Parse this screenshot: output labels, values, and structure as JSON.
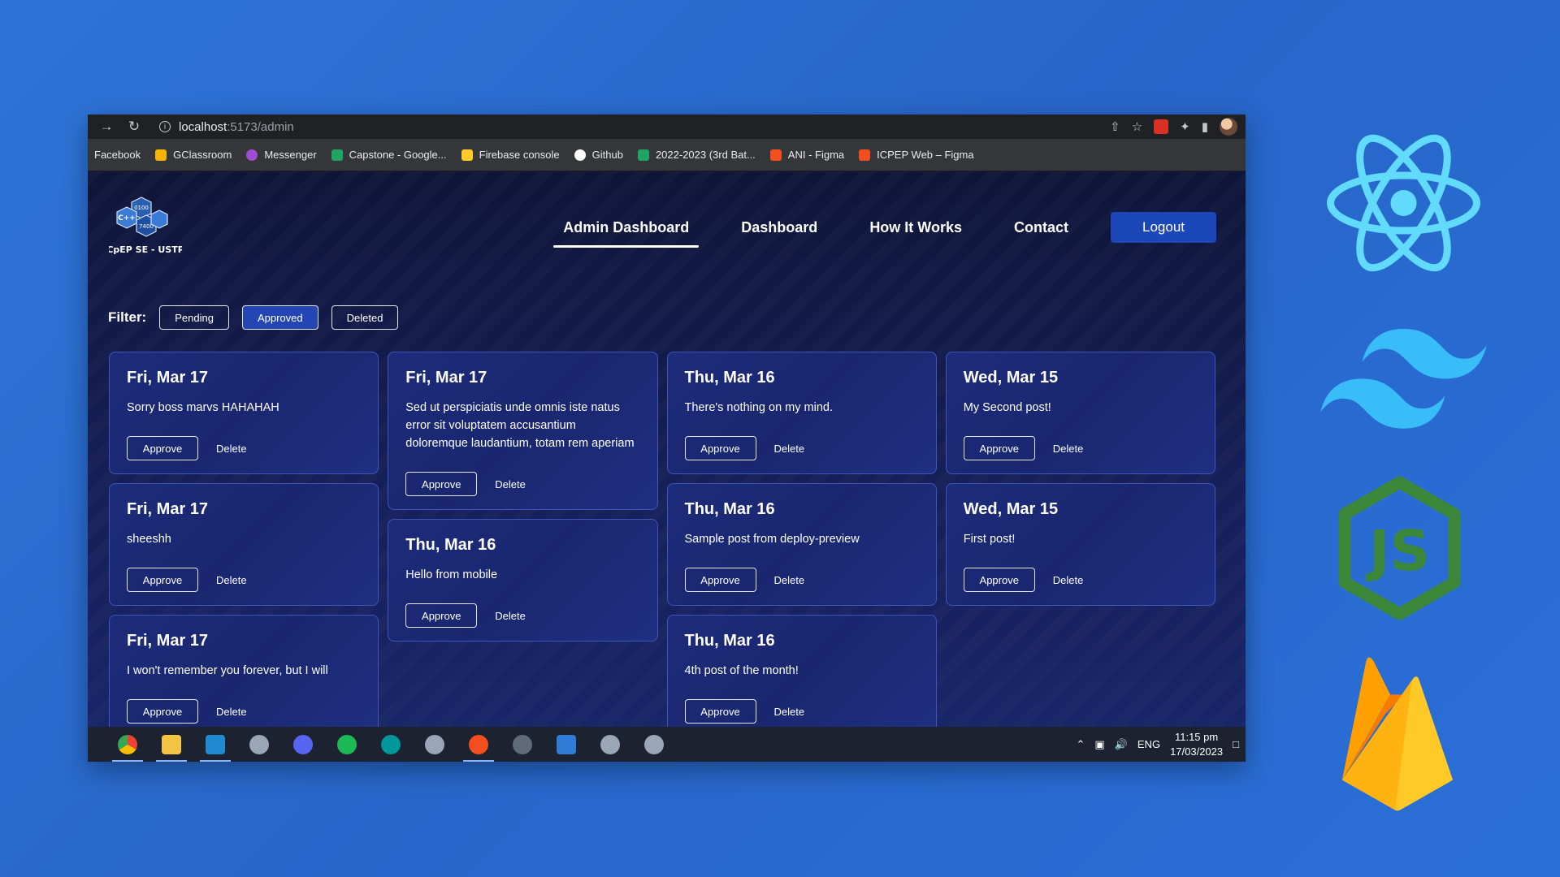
{
  "browser": {
    "url_host": "localhost",
    "url_path": ":5173/admin",
    "bookmarks": [
      {
        "label": "Facebook",
        "icon": "facebook-icon",
        "color": ""
      },
      {
        "label": "GClassroom",
        "icon": "classroom-icon",
        "color": "#f6b400"
      },
      {
        "label": "Messenger",
        "icon": "messenger-icon",
        "color": "#a04bd4"
      },
      {
        "label": "Capstone - Google...",
        "icon": "drive-icon",
        "color": "#1fa463"
      },
      {
        "label": "Firebase console",
        "icon": "firebase-icon",
        "color": "#ffca28"
      },
      {
        "label": "Github",
        "icon": "github-icon",
        "color": "#ffffff"
      },
      {
        "label": "2022-2023 (3rd Bat...",
        "icon": "drive-icon",
        "color": "#1fa463"
      },
      {
        "label": "ANI - Figma",
        "icon": "figma-icon",
        "color": "#f24e1e"
      },
      {
        "label": "ICPEP Web – Figma",
        "icon": "figma-icon",
        "color": "#f24e1e"
      }
    ]
  },
  "site": {
    "logo_text": "ICpEP SE - USTP",
    "nav": {
      "admin_dashboard": "Admin Dashboard",
      "dashboard": "Dashboard",
      "how_it_works": "How It Works",
      "contact": "Contact",
      "logout": "Logout"
    },
    "filter": {
      "label": "Filter:",
      "pending": "Pending",
      "approved": "Approved",
      "deleted": "Deleted",
      "active": "Approved"
    },
    "actions": {
      "approve": "Approve",
      "delete": "Delete"
    },
    "columns": [
      [
        {
          "date": "Fri, Mar 17",
          "text": "Sorry boss marvs HAHAHAH"
        },
        {
          "date": "Fri, Mar 17",
          "text": "sheeshh"
        },
        {
          "date": "Fri, Mar 17",
          "text": "I won't remember you forever, but I will"
        }
      ],
      [
        {
          "date": "Fri, Mar 17",
          "text": "Sed ut perspiciatis unde omnis iste natus error sit voluptatem accusantium doloremque laudantium, totam rem aperiam"
        },
        {
          "date": "Thu, Mar 16",
          "text": "Hello from mobile"
        }
      ],
      [
        {
          "date": "Thu, Mar 16",
          "text": "There's nothing on my mind."
        },
        {
          "date": "Thu, Mar 16",
          "text": "Sample post from deploy-preview"
        },
        {
          "date": "Thu, Mar 16",
          "text": "4th post of the month!"
        }
      ],
      [
        {
          "date": "Wed, Mar 15",
          "text": "My Second post!"
        },
        {
          "date": "Wed, Mar 15",
          "text": "First post!"
        }
      ]
    ]
  },
  "taskbar": {
    "apps": [
      "chrome-icon",
      "file-explorer-icon",
      "vscode-icon",
      "app-icon",
      "discord-icon",
      "spotify-icon",
      "arduino-icon",
      "app-icon",
      "figma-icon",
      "settings-icon",
      "news-icon",
      "app-icon",
      "app-icon"
    ],
    "lang": "ENG",
    "time": "11:15 pm",
    "date": "17/03/2023"
  },
  "colors": {
    "background": "#2a6fd8",
    "page_bg": "#0f1538",
    "card_bg": "#1c2b7a",
    "accent": "#1b47b8"
  }
}
